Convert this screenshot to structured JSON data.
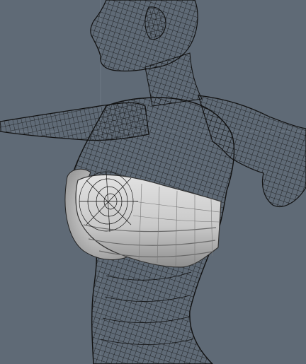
{
  "viewport": {
    "background_color": "#5f6a76",
    "grid_color": "#6d7884",
    "wireframe_color": "#111111",
    "shaded_surface_color": "#d2d2d2",
    "shaded_shadow_color": "#9a9a9a"
  },
  "scene_objects": [
    {
      "label": "character-wireframe-mesh",
      "style": "wireframe"
    },
    {
      "label": "bandeau-top-garment",
      "style": "shaded-with-wire"
    }
  ]
}
